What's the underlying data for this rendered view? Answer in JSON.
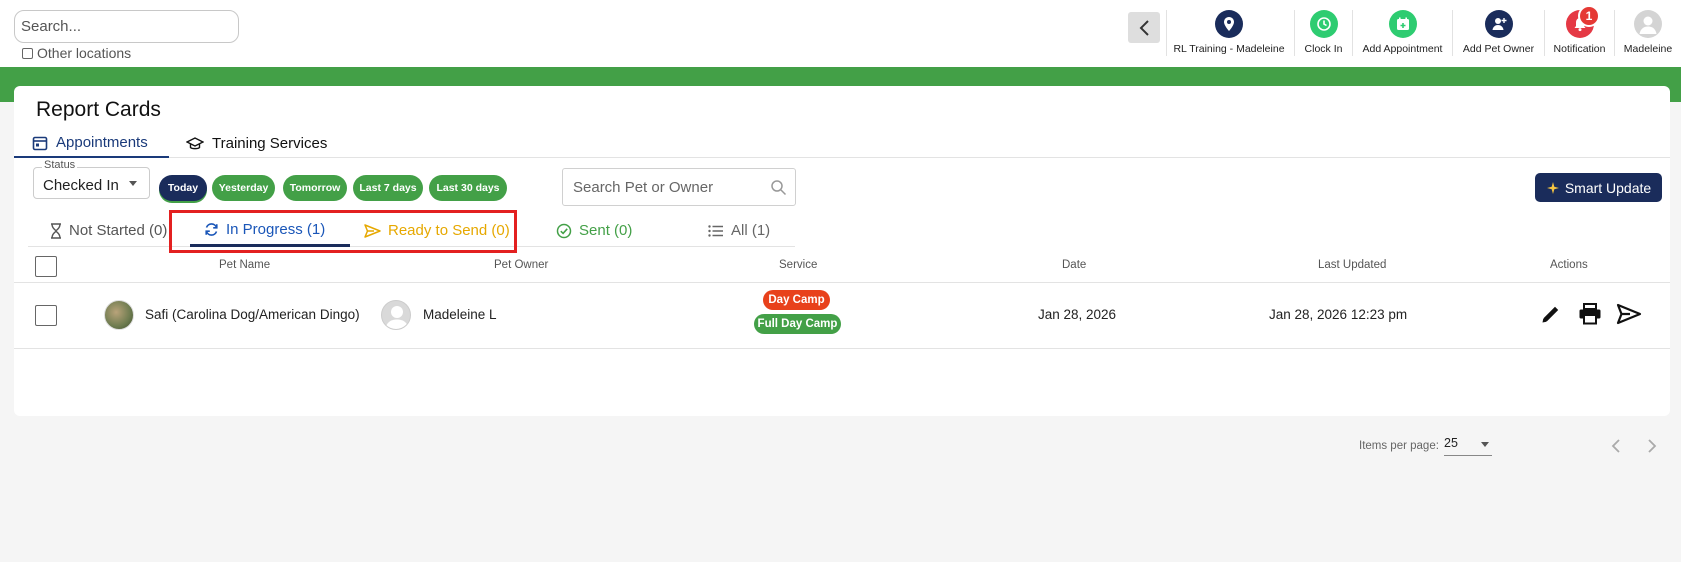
{
  "header": {
    "search_placeholder": "Search...",
    "other_locations_label": "Other locations",
    "nav": [
      {
        "label": "RL Training - Madeleine",
        "icon": "location-pin-icon",
        "color": "#1a2c5b"
      },
      {
        "label": "Clock In",
        "icon": "clock-icon",
        "color": "#2ecc71"
      },
      {
        "label": "Add Appointment",
        "icon": "calendar-add-icon",
        "color": "#2ecc71"
      },
      {
        "label": "Add Pet Owner",
        "icon": "add-user-icon",
        "color": "#1a2c5b"
      },
      {
        "label": "Notification",
        "icon": "bell-icon",
        "color": "#e53945",
        "badge": "1"
      },
      {
        "label": "Madeleine",
        "icon": "user-avatar-icon",
        "color": "#cccccc"
      }
    ]
  },
  "page": {
    "title": "Report Cards",
    "tabs": [
      {
        "label": "Appointments",
        "icon": "calendar-icon",
        "active": true
      },
      {
        "label": "Training Services",
        "icon": "graduation-cap-icon",
        "active": false
      }
    ]
  },
  "filters": {
    "status_label": "Status",
    "status_value": "Checked In",
    "date_chips": [
      "Today",
      "Yesterday",
      "Tomorrow",
      "Last 7 days",
      "Last 30 days"
    ],
    "active_chip": "Today",
    "pet_search_placeholder": "Search Pet or Owner",
    "smart_update_label": "Smart Update"
  },
  "status_tabs": [
    {
      "label": "Not Started (0)",
      "icon": "hourglass-icon",
      "color": "#555555"
    },
    {
      "label": "In Progress (1)",
      "icon": "refresh-icon",
      "color": "#1a56b8",
      "active": true
    },
    {
      "label": "Ready to Send (0)",
      "icon": "send-icon",
      "color": "#e6a800"
    },
    {
      "label": "Sent (0)",
      "icon": "check-circle-icon",
      "color": "#43a047"
    },
    {
      "label": "All (1)",
      "icon": "list-icon",
      "color": "#666666"
    }
  ],
  "table": {
    "columns": [
      "Pet Name",
      "Pet Owner",
      "Service",
      "Date",
      "Last Updated",
      "Actions"
    ],
    "rows": [
      {
        "pet_name": "Safi (Carolina Dog/American Dingo)",
        "pet_owner": "Madeleine L",
        "services": [
          "Day Camp",
          "Full Day Camp"
        ],
        "date": "Jan 28, 2026",
        "last_updated": "Jan 28, 2026 12:23 pm"
      }
    ]
  },
  "pagination": {
    "items_per_page_label": "Items per page:",
    "items_per_page_value": "25"
  },
  "colors": {
    "brand_green": "#43a047",
    "brand_navy": "#1a2c5b",
    "highlight_red": "#e32020"
  }
}
